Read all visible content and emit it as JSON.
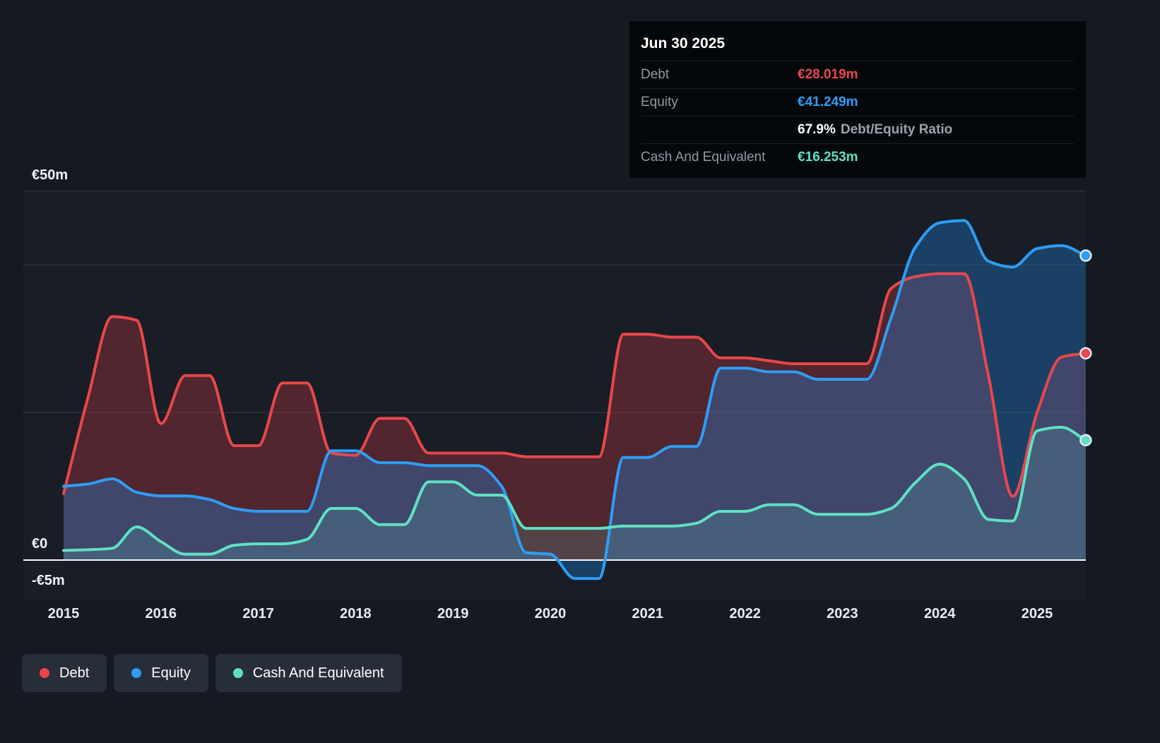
{
  "tooltip": {
    "date": "Jun 30 2025",
    "rows": [
      {
        "label": "Debt",
        "value": "€28.019m",
        "value_color": "#e8474b"
      },
      {
        "label": "Equity",
        "value": "€41.249m",
        "value_color": "#2e9df5"
      },
      {
        "label": "",
        "value": "67.9%",
        "suffix": "Debt/Equity Ratio",
        "value_color": "#ffffff"
      },
      {
        "label": "Cash And Equivalent",
        "value": "€16.253m",
        "value_color": "#5fe0c4"
      }
    ]
  },
  "legend": [
    {
      "label": "Debt",
      "color": "#e8474b"
    },
    {
      "label": "Equity",
      "color": "#2e9df5"
    },
    {
      "label": "Cash And Equivalent",
      "color": "#5fe0c4"
    }
  ],
  "axes": {
    "y_labels": [
      {
        "text": "€50m",
        "value": 50
      },
      {
        "text": "€0",
        "value": 0
      },
      {
        "text": "-€5m",
        "value": -5
      }
    ],
    "x_ticks": [
      "2015",
      "2016",
      "2017",
      "2018",
      "2019",
      "2020",
      "2021",
      "2022",
      "2023",
      "2024",
      "2025"
    ]
  },
  "chart_data": {
    "type": "area",
    "unit": "€m",
    "x_range": [
      2015,
      2025.5
    ],
    "ylim": [
      -5,
      50
    ],
    "grid_values": [
      50,
      40,
      20
    ],
    "zero_line": true,
    "legend_position": "bottom-left",
    "x": [
      2015,
      2015.25,
      2015.5,
      2015.75,
      2016,
      2016.25,
      2016.5,
      2016.75,
      2017,
      2017.25,
      2017.5,
      2017.75,
      2018,
      2018.25,
      2018.5,
      2018.75,
      2019,
      2019.25,
      2019.5,
      2019.75,
      2020,
      2020.25,
      2020.5,
      2020.75,
      2021,
      2021.25,
      2021.5,
      2021.75,
      2022,
      2022.25,
      2022.5,
      2022.75,
      2023,
      2023.25,
      2023.5,
      2023.75,
      2024,
      2024.25,
      2024.5,
      2024.75,
      2025,
      2025.25,
      2025.5
    ],
    "series": [
      {
        "name": "Debt",
        "color": "#e8474b",
        "fill": "rgba(226,61,68,0.28)",
        "values": [
          9,
          22,
          33,
          32.5,
          18.5,
          25,
          25,
          15.5,
          15.5,
          24,
          24,
          14.5,
          14.2,
          19.2,
          19.2,
          14.5,
          14.5,
          14.5,
          14.5,
          14,
          14,
          14,
          14,
          30.6,
          30.6,
          30.2,
          30.2,
          27.4,
          27.4,
          27,
          26.6,
          26.6,
          26.6,
          26.6,
          36.8,
          38.4,
          38.8,
          38.8,
          25,
          8.6,
          20,
          27.5,
          28.019
        ]
      },
      {
        "name": "Equity",
        "color": "#2e9df5",
        "fill": "rgba(31,140,235,0.32)",
        "values": [
          10,
          10.3,
          11,
          9.2,
          8.7,
          8.7,
          8.2,
          7,
          6.6,
          6.6,
          6.6,
          14.8,
          14.8,
          13.2,
          13.2,
          12.8,
          12.8,
          12.8,
          10,
          1,
          0.8,
          -2.5,
          -2.5,
          13.9,
          13.9,
          15.4,
          15.4,
          26,
          26,
          25.5,
          25.5,
          24.5,
          24.5,
          24.5,
          32.8,
          42.4,
          45.7,
          46,
          40.5,
          39.7,
          42.2,
          42.6,
          41.249
        ]
      },
      {
        "name": "Cash And Equivalent",
        "color": "#5fe0c4",
        "fill": "rgba(100,224,197,0.16)",
        "values": [
          1.3,
          1.4,
          1.6,
          4.5,
          2.5,
          0.8,
          0.8,
          2,
          2.2,
          2.2,
          2.8,
          7,
          7,
          4.8,
          4.8,
          10.6,
          10.6,
          8.8,
          8.8,
          4.3,
          4.3,
          4.3,
          4.3,
          4.6,
          4.6,
          4.6,
          5,
          6.6,
          6.6,
          7.5,
          7.5,
          6.2,
          6.2,
          6.2,
          7,
          10.5,
          13,
          11,
          5.5,
          5.3,
          17.5,
          18,
          16.253
        ]
      }
    ]
  }
}
